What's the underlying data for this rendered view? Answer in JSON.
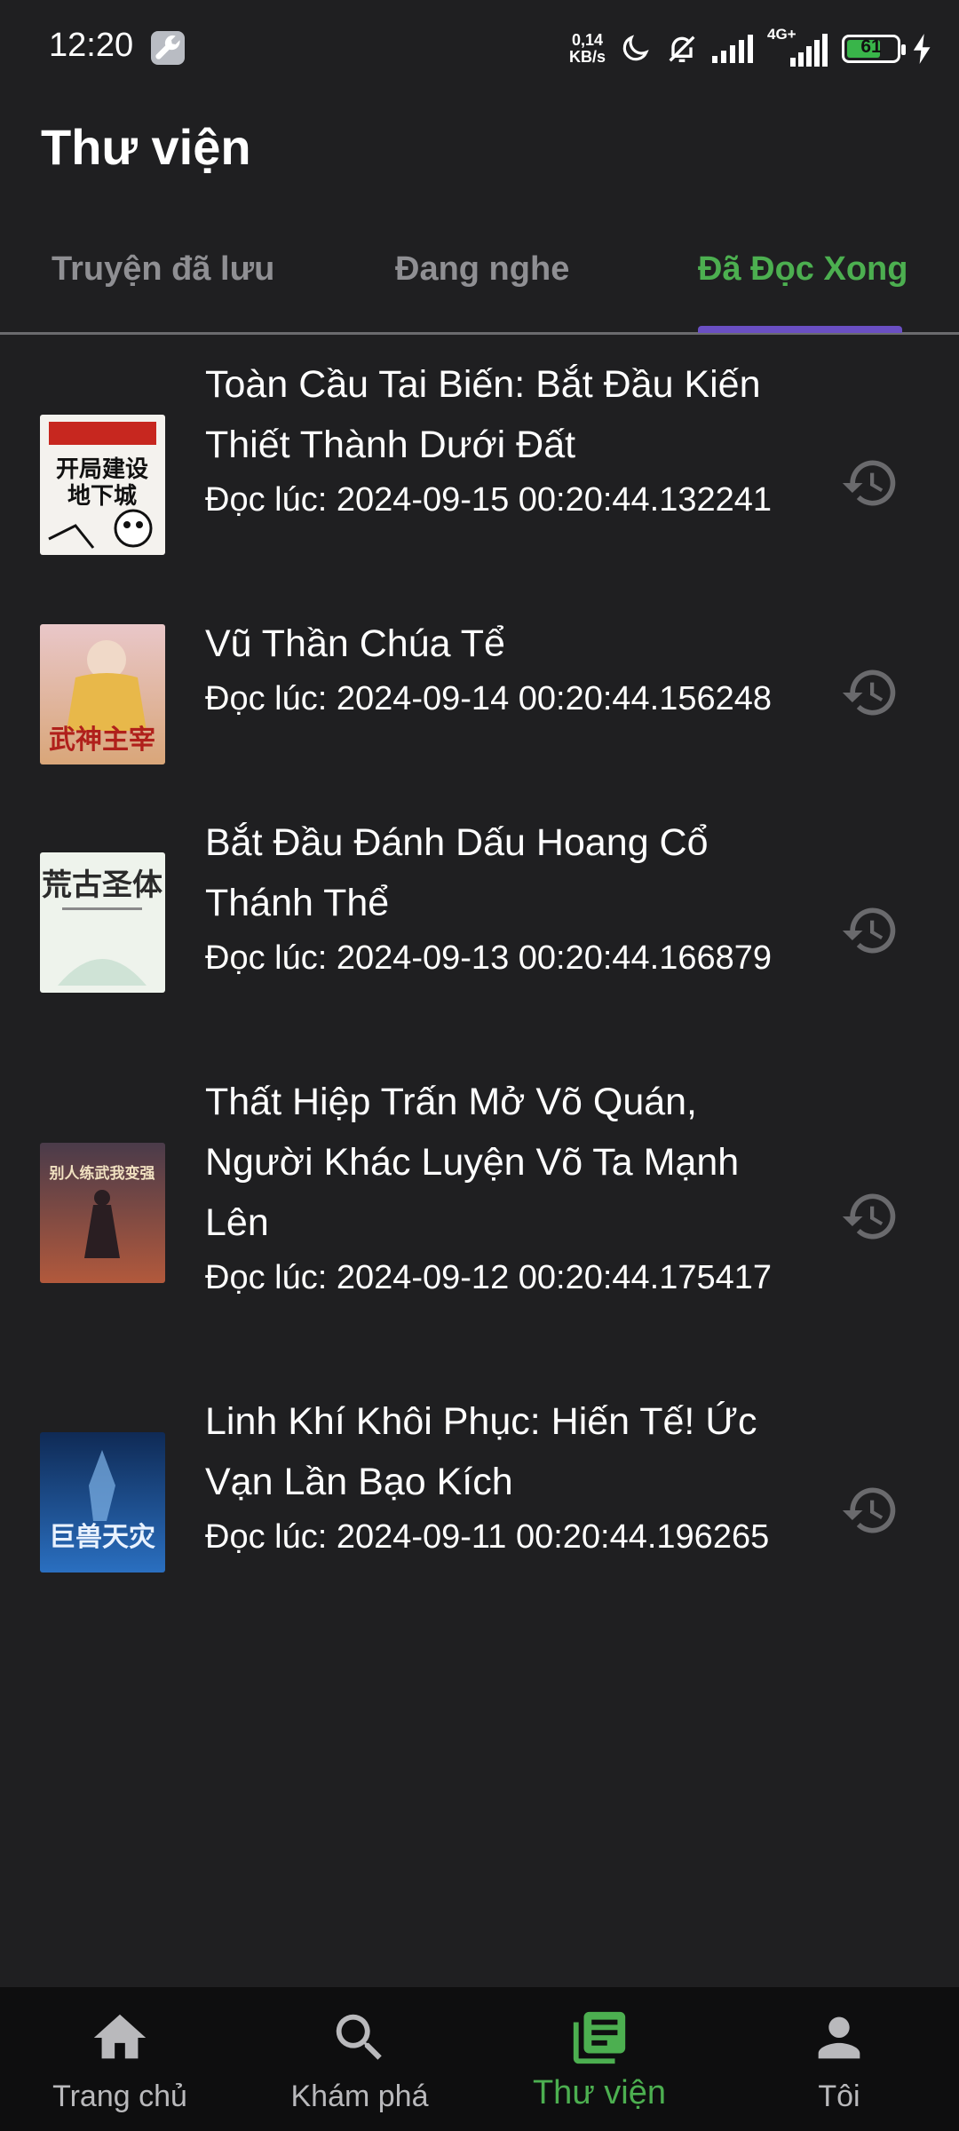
{
  "status_bar": {
    "time": "12:20",
    "net_speed_value": "0,14",
    "net_speed_unit": "KB/s",
    "network_type": "4G+",
    "battery_level": "61",
    "icons": [
      "wrench-icon",
      "moon-icon",
      "bell-off-icon",
      "signal-icon",
      "signal-4g-icon",
      "battery-icon",
      "charging-icon"
    ]
  },
  "header": {
    "title": "Thư viện"
  },
  "tabs": [
    {
      "label": "Truyện đã lưu",
      "active": false
    },
    {
      "label": "Đang nghe",
      "active": false
    },
    {
      "label": "Đã Đọc Xong",
      "active": true
    }
  ],
  "books": [
    {
      "title": "Toàn Cầu Tai Biến: Bắt Đầu Kiến Thiết Thành Dưới Đất",
      "read_at": "Đọc lúc: 2024-09-15 00:20:44.132241",
      "cover_text": "开局建设地下城"
    },
    {
      "title": "Vũ Thần Chúa Tể",
      "read_at": "Đọc lúc: 2024-09-14 00:20:44.156248",
      "cover_text": "武神主宰"
    },
    {
      "title": "Bắt Đầu Đánh Dấu Hoang Cổ Thánh Thể",
      "read_at": "Đọc lúc: 2024-09-13 00:20:44.166879",
      "cover_text": "荒古圣体"
    },
    {
      "title": "Thất Hiệp Trấn Mở Võ Quán, Người Khác Luyện Võ Ta Mạnh Lên",
      "read_at": "Đọc lúc: 2024-09-12 00:20:44.175417",
      "cover_text": "别人练武我变强"
    },
    {
      "title": "Linh Khí Khôi Phục: Hiến Tế! Ức Vạn Lần Bạo Kích",
      "read_at": "Đọc lúc: 2024-09-11 00:20:44.196265",
      "cover_text": "巨兽天灾"
    }
  ],
  "bottom_nav": [
    {
      "label": "Trang chủ",
      "icon": "home-icon",
      "active": false
    },
    {
      "label": "Khám phá",
      "icon": "search-icon",
      "active": false
    },
    {
      "label": "Thư viện",
      "icon": "library-icon",
      "active": true
    },
    {
      "label": "Tôi",
      "icon": "person-icon",
      "active": false
    }
  ],
  "colors": {
    "background": "#1f1f21",
    "accent": "#4caf50",
    "tab_indicator": "#6a4fc3",
    "nav_background": "#0e0e0f"
  }
}
